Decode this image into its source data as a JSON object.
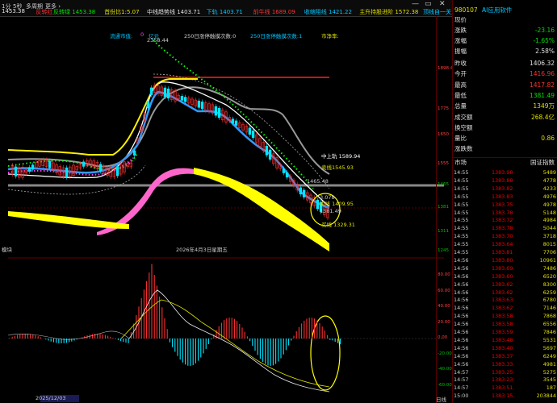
{
  "topbar": {
    "items": [
      {
        "text": "1分",
        "color": "#ccc"
      },
      {
        "text": "5秒",
        "color": "#ccc"
      },
      {
        "text": "多周期",
        "color": "#ccc"
      },
      {
        "text": "更多 ›",
        "color": "#ccc"
      }
    ],
    "indicators": [
      {
        "text": "1453.38",
        "color": "#e0e0e0"
      },
      {
        "text": "反转红",
        "color": "#ff3030"
      },
      {
        "text": "反转绿 1453.38",
        "color": "#00e000"
      },
      {
        "text": "首份比1:5.07",
        "color": "#e0e000"
      },
      {
        "text": "中线趋势线 1403.71",
        "color": "#e0e0e0"
      },
      {
        "text": "下轨 1403.71",
        "color": "#00c8ff"
      },
      {
        "text": "前牛线 1689.09",
        "color": "#ff3030"
      },
      {
        "text": "收缩阻线 1421.22",
        "color": "#00c8ff"
      },
      {
        "text": "主升持股进阶 1572.38",
        "color": "#e0e000"
      },
      {
        "text": "顶线自一关主 1572.38",
        "color": "#00c8ff"
      }
    ],
    "window_buttons": [
      "—",
      "▭",
      "✕"
    ]
  },
  "chart_labels": {
    "legend1": "流通市值:",
    "legend1_val": "0",
    "legend1_unit": "亿元",
    "legend2": "250日涨停触摸次数:0",
    "legend3": "250日涨停触摸次数:1",
    "legend4": "市净率:",
    "peak_price": "2358.44",
    "zhong_shang": "中上轨 1589.94",
    "mai_xian_top": "卖线1545.93",
    "val_1465": "1465.48",
    "val_1378": "3.078",
    "mai_xian_mid": "卖线 1409.95",
    "val_1381": "1381.49",
    "mai_xian_bottom": "买线 1329.31",
    "date_label": "2026年4月3日星期五",
    "left_tag": "模块",
    "bottom_date": "2025/12/03",
    "bottom_right": "日线"
  },
  "price_scale": [
    "1898.4",
    "1775",
    "1650",
    "1555",
    "1465",
    "1381",
    "1311",
    "1245"
  ],
  "macd_scale": [
    "80.00",
    "60.00",
    "40.00",
    "20.00",
    "0.00",
    "-20.00",
    "-40.00",
    "-60.00"
  ],
  "header": {
    "code": "980107",
    "name": "AI应用软件"
  },
  "quote": [
    {
      "label": "现价",
      "value": "",
      "color": "#e0e0e0"
    },
    {
      "label": "涨跌",
      "value": "-23.16",
      "color": "#00e000"
    },
    {
      "label": "涨幅",
      "value": "-1.65%",
      "color": "#00e000"
    },
    {
      "label": "振幅",
      "value": "2.58%",
      "color": "#e0e0e0"
    }
  ],
  "stats": [
    {
      "label": "昨收",
      "value": "1406.32",
      "color": "#e0e0e0"
    },
    {
      "label": "今开",
      "value": "1416.96",
      "color": "#ff3030"
    },
    {
      "label": "最高",
      "value": "1417.82",
      "color": "#ff3030"
    },
    {
      "label": "最低",
      "value": "1381.49",
      "color": "#00e000"
    },
    {
      "label": "总量",
      "value": "1349万",
      "color": "#e0e000"
    },
    {
      "label": "成交额",
      "value": "268.4亿",
      "color": "#e0e000"
    },
    {
      "label": "换空额",
      "value": "",
      "color": "#e0e0e0"
    },
    {
      "label": "量比",
      "value": "0.86",
      "color": "#e0e000"
    },
    {
      "label": "涨跌数",
      "value": "",
      "color": "#e0e0e0"
    }
  ],
  "market": {
    "left": "市场",
    "right": "国证指数"
  },
  "ticks": [
    {
      "t": "14:55",
      "p": "1383.98",
      "v": "5489"
    },
    {
      "t": "14:55",
      "p": "1383.88",
      "v": "4778"
    },
    {
      "t": "14:55",
      "p": "1383.82",
      "v": "4233"
    },
    {
      "t": "14:55",
      "p": "1383.83",
      "v": "4976"
    },
    {
      "t": "14:55",
      "p": "1383.75",
      "v": "4978"
    },
    {
      "t": "14:55",
      "p": "1383.78",
      "v": "5148"
    },
    {
      "t": "14:55",
      "p": "1383.72",
      "v": "4984"
    },
    {
      "t": "14:55",
      "p": "1383.78",
      "v": "5044"
    },
    {
      "t": "14:55",
      "p": "1383.70",
      "v": "3718"
    },
    {
      "t": "14:55",
      "p": "1383.64",
      "v": "8015"
    },
    {
      "t": "14:55",
      "p": "1383.81",
      "v": "7706"
    },
    {
      "t": "14:56",
      "p": "1383.80",
      "v": "10961"
    },
    {
      "t": "14:56",
      "p": "1383.69",
      "v": "7486"
    },
    {
      "t": "14:56",
      "p": "1383.60",
      "v": "6520"
    },
    {
      "t": "14:56",
      "p": "1383.62",
      "v": "8300"
    },
    {
      "t": "14:56",
      "p": "1383.62",
      "v": "6259"
    },
    {
      "t": "14:56",
      "p": "1383.63",
      "v": "6780"
    },
    {
      "t": "14:56",
      "p": "1383.62",
      "v": "7146"
    },
    {
      "t": "14:56",
      "p": "1383.58",
      "v": "7868"
    },
    {
      "t": "14:56",
      "p": "1383.58",
      "v": "6556"
    },
    {
      "t": "14:56",
      "p": "1383.59",
      "v": "7846"
    },
    {
      "t": "14:56",
      "p": "1383.48",
      "v": "5531"
    },
    {
      "t": "14:56",
      "p": "1383.40",
      "v": "5697"
    },
    {
      "t": "14:56",
      "p": "1383.37",
      "v": "6249"
    },
    {
      "t": "14:56",
      "p": "1383.33",
      "v": "4981"
    },
    {
      "t": "14:57",
      "p": "1383.25",
      "v": "5275"
    },
    {
      "t": "14:57",
      "p": "1383.23",
      "v": "3545"
    },
    {
      "t": "14:57",
      "p": "1383.51",
      "v": "187"
    },
    {
      "t": "15:00",
      "p": "1383.15",
      "v": "203844"
    }
  ]
}
